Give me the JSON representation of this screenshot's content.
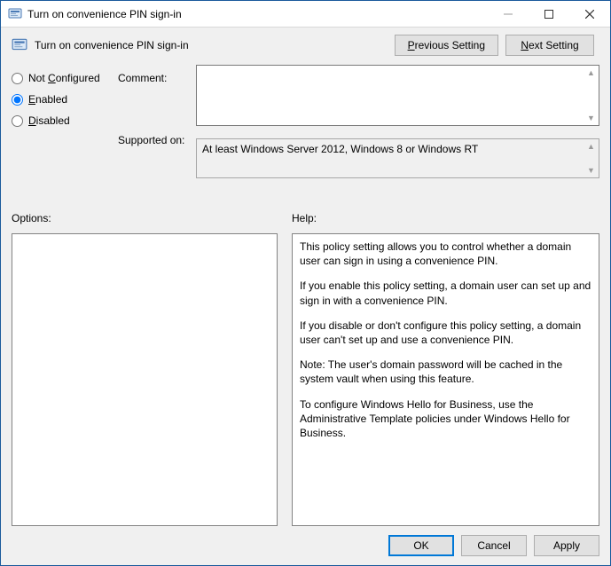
{
  "window": {
    "title": "Turn on convenience PIN sign-in"
  },
  "policy": {
    "title": "Turn on convenience PIN sign-in"
  },
  "nav": {
    "previous_prefix": "P",
    "previous_rest": "revious Setting",
    "next_prefix": "N",
    "next_rest": "ext Setting"
  },
  "state": {
    "not_configured_prefix": "C",
    "not_configured_label_pre": "Not ",
    "not_configured_label_post": "onfigured",
    "enabled_prefix": "E",
    "enabled_rest": "nabled",
    "disabled_prefix": "D",
    "disabled_rest": "isabled",
    "selected": "enabled"
  },
  "fields": {
    "comment_label": "Comment:",
    "comment_value": "",
    "supported_label": "Supported on:",
    "supported_value": "At least Windows Server 2012, Windows 8 or Windows RT"
  },
  "sections": {
    "options_label": "Options:",
    "help_label": "Help:"
  },
  "help": {
    "p1": "This policy setting allows you to control whether a domain user can sign in using a convenience PIN.",
    "p2": "If you enable this policy setting, a domain user can set up and sign in with a convenience PIN.",
    "p3": "If you disable or don't configure this policy setting, a domain user can't set up and use a convenience PIN.",
    "p4": "Note: The user's domain password will be cached in the system vault when using this feature.",
    "p5": "To configure Windows Hello for Business, use the Administrative Template policies under Windows Hello for Business."
  },
  "footer": {
    "ok": "OK",
    "cancel": "Cancel",
    "apply": "Apply"
  }
}
